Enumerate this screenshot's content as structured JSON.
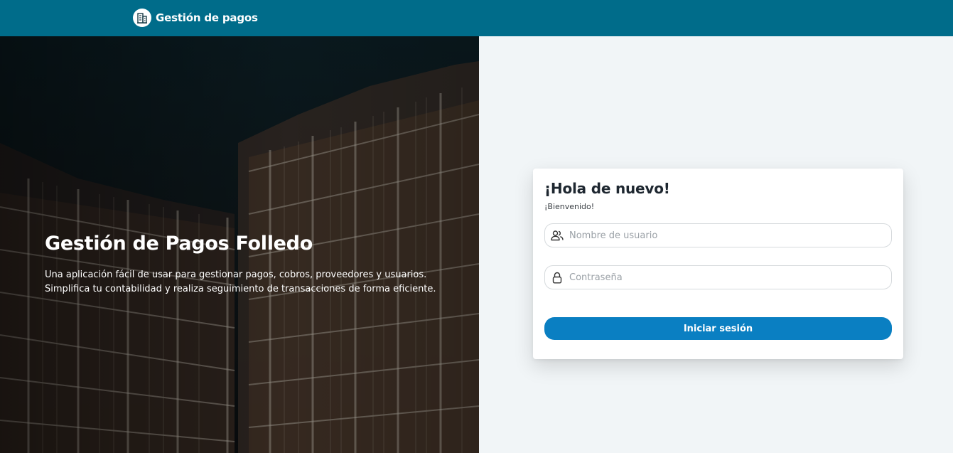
{
  "header": {
    "brand_name": "Gestión de pagos",
    "logo_icon": "building-icon",
    "background_color": "#006c8a"
  },
  "hero": {
    "title": "Gestión de Pagos Folledo",
    "description_line1": "Una aplicación fácil de usar para gestionar pagos, cobros, proveedores y usuarios.",
    "description_line2": "Simplifica tu contabilidad y realiza seguimiento de transacciones de forma eficiente."
  },
  "login": {
    "title": "¡Hola de nuevo!",
    "subtitle": "¡Bienvenido!",
    "username": {
      "value": "",
      "placeholder": "Nombre de usuario",
      "icon": "users-icon"
    },
    "password": {
      "value": "",
      "placeholder": "Contraseña",
      "icon": "lock-icon"
    },
    "submit_label": "Iniciar sesión",
    "button_color": "#0a7fc2"
  }
}
